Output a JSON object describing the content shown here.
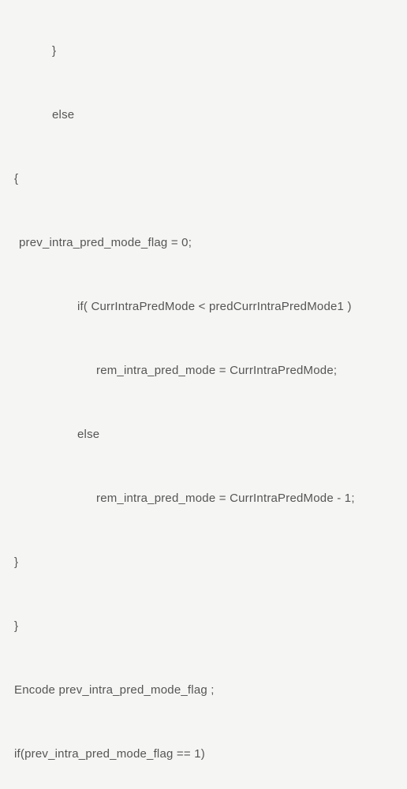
{
  "code": {
    "l1": "}",
    "l2": "else",
    "l3": "{",
    "l4": "prev_intra_pred_mode_flag = 0;",
    "l5": "if( CurrIntraPredMode < predCurrIntraPredMode1 )",
    "l6": "rem_intra_pred_mode = CurrIntraPredMode;",
    "l7": "else",
    "l8": "rem_intra_pred_mode = CurrIntraPredMode - 1;",
    "l9": "}",
    "l10": "}",
    "l11": "Encode prev_intra_pred_mode_flag ;",
    "l12": "if(prev_intra_pred_mode_flag == 1)"
  }
}
